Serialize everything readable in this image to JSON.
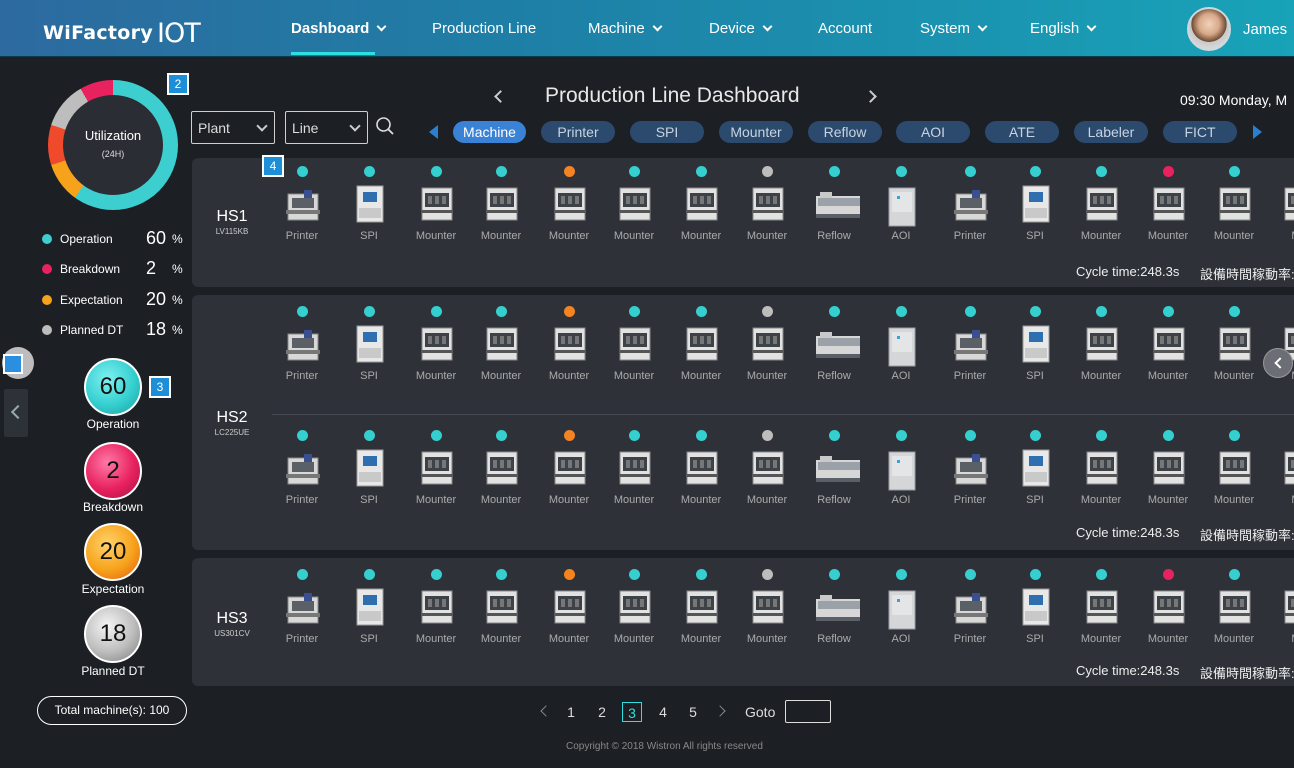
{
  "app": {
    "brand": "WiFactory",
    "brand_iot": "IOT"
  },
  "nav": {
    "items": [
      {
        "label": "Dashboard",
        "active": true,
        "has_dropdown": true
      },
      {
        "label": "Production Line",
        "active": false,
        "has_dropdown": false
      },
      {
        "label": "Machine",
        "active": false,
        "has_dropdown": true
      },
      {
        "label": "Device",
        "active": false,
        "has_dropdown": true
      },
      {
        "label": "Account",
        "active": false,
        "has_dropdown": false
      },
      {
        "label": "System",
        "active": false,
        "has_dropdown": true
      },
      {
        "label": "English",
        "active": false,
        "has_dropdown": true
      }
    ],
    "user": "James"
  },
  "utilization": {
    "title": "Utilization",
    "subtitle": "(24H)",
    "badge": "2",
    "legend": [
      {
        "label": "Operation",
        "value": "60",
        "unit": "%",
        "color": "#3dcfcf"
      },
      {
        "label": "Breakdown",
        "value": "2",
        "unit": "%",
        "color": "#e8215f"
      },
      {
        "label": "Expectation",
        "value": "20",
        "unit": "%",
        "color": "#f7a21b"
      },
      {
        "label": "Planned DT",
        "value": "18",
        "unit": "%",
        "color": "#bdbdbd"
      }
    ]
  },
  "stats": {
    "badge": "3",
    "items": [
      {
        "value": "60",
        "label": "Operation",
        "color": "#3dcfcf"
      },
      {
        "value": "2",
        "label": "Breakdown",
        "color": "#e8215f"
      },
      {
        "value": "20",
        "label": "Expectation",
        "color": "#f7a21b"
      },
      {
        "value": "18",
        "label": "Planned DT",
        "color": "#bdbdbd"
      }
    ],
    "total": "Total machine(s): 100"
  },
  "header": {
    "title": "Production Line Dashboard",
    "datetime": "09:30 Monday, M"
  },
  "filters": {
    "plant": "Plant",
    "line": "Line"
  },
  "tabs": [
    {
      "label": "Machine",
      "active": true
    },
    {
      "label": "Printer",
      "active": false
    },
    {
      "label": "SPI",
      "active": false
    },
    {
      "label": "Mounter",
      "active": false
    },
    {
      "label": "Reflow",
      "active": false
    },
    {
      "label": "AOI",
      "active": false
    },
    {
      "label": "ATE",
      "active": false
    },
    {
      "label": "Labeler",
      "active": false
    },
    {
      "label": "FICT",
      "active": false
    }
  ],
  "lines_badge": "4",
  "lines": [
    {
      "name": "HS1",
      "code": "LV115KB",
      "cycle": "Cycle time:248.3s",
      "availability": "設備時間稼動率:",
      "rows": [
        [
          {
            "type": "Printer",
            "status": "operation"
          },
          {
            "type": "SPI",
            "status": "operation"
          },
          {
            "type": "Mounter",
            "status": "operation"
          },
          {
            "type": "Mounter",
            "status": "operation"
          },
          {
            "type": "Mounter",
            "status": "expectation"
          },
          {
            "type": "Mounter",
            "status": "operation"
          },
          {
            "type": "Mounter",
            "status": "operation"
          },
          {
            "type": "Mounter",
            "status": "planned"
          },
          {
            "type": "Reflow",
            "status": "operation"
          },
          {
            "type": "AOI",
            "status": "operation"
          },
          {
            "type": "Printer",
            "status": "operation"
          },
          {
            "type": "SPI",
            "status": "operation"
          },
          {
            "type": "Mounter",
            "status": "operation"
          },
          {
            "type": "Mounter",
            "status": "breakdown"
          },
          {
            "type": "Mounter",
            "status": "operation"
          },
          {
            "type": "Mo",
            "status": "none"
          }
        ]
      ]
    },
    {
      "name": "HS2",
      "code": "LC225UE",
      "cycle": "Cycle time:248.3s",
      "availability": "設備時間稼動率:",
      "rows": [
        [
          {
            "type": "Printer",
            "status": "operation"
          },
          {
            "type": "SPI",
            "status": "operation"
          },
          {
            "type": "Mounter",
            "status": "operation"
          },
          {
            "type": "Mounter",
            "status": "operation"
          },
          {
            "type": "Mounter",
            "status": "expectation"
          },
          {
            "type": "Mounter",
            "status": "operation"
          },
          {
            "type": "Mounter",
            "status": "operation"
          },
          {
            "type": "Mounter",
            "status": "planned"
          },
          {
            "type": "Reflow",
            "status": "operation"
          },
          {
            "type": "AOI",
            "status": "operation"
          },
          {
            "type": "Printer",
            "status": "operation"
          },
          {
            "type": "SPI",
            "status": "operation"
          },
          {
            "type": "Mounter",
            "status": "operation"
          },
          {
            "type": "Mounter",
            "status": "operation"
          },
          {
            "type": "Mounter",
            "status": "operation"
          },
          {
            "type": "Mo",
            "status": "none"
          }
        ],
        [
          {
            "type": "Printer",
            "status": "operation"
          },
          {
            "type": "SPI",
            "status": "operation"
          },
          {
            "type": "Mounter",
            "status": "operation"
          },
          {
            "type": "Mounter",
            "status": "operation"
          },
          {
            "type": "Mounter",
            "status": "expectation"
          },
          {
            "type": "Mounter",
            "status": "operation"
          },
          {
            "type": "Mounter",
            "status": "operation"
          },
          {
            "type": "Mounter",
            "status": "planned"
          },
          {
            "type": "Reflow",
            "status": "operation"
          },
          {
            "type": "AOI",
            "status": "operation"
          },
          {
            "type": "Printer",
            "status": "operation"
          },
          {
            "type": "SPI",
            "status": "operation"
          },
          {
            "type": "Mounter",
            "status": "operation"
          },
          {
            "type": "Mounter",
            "status": "operation"
          },
          {
            "type": "Mounter",
            "status": "operation"
          },
          {
            "type": "Mo",
            "status": "none"
          }
        ]
      ]
    },
    {
      "name": "HS3",
      "code": "US301CV",
      "cycle": "Cycle time:248.3s",
      "availability": "設備時間稼動率:",
      "rows": [
        [
          {
            "type": "Printer",
            "status": "operation"
          },
          {
            "type": "SPI",
            "status": "operation"
          },
          {
            "type": "Mounter",
            "status": "operation"
          },
          {
            "type": "Mounter",
            "status": "operation"
          },
          {
            "type": "Mounter",
            "status": "expectation"
          },
          {
            "type": "Mounter",
            "status": "operation"
          },
          {
            "type": "Mounter",
            "status": "operation"
          },
          {
            "type": "Mounter",
            "status": "planned"
          },
          {
            "type": "Reflow",
            "status": "operation"
          },
          {
            "type": "AOI",
            "status": "operation"
          },
          {
            "type": "Printer",
            "status": "operation"
          },
          {
            "type": "SPI",
            "status": "operation"
          },
          {
            "type": "Mounter",
            "status": "operation"
          },
          {
            "type": "Mounter",
            "status": "breakdown"
          },
          {
            "type": "Mounter",
            "status": "operation"
          },
          {
            "type": "Mo",
            "status": "none"
          }
        ]
      ]
    }
  ],
  "status_colors": {
    "operation": "#35cfd0",
    "expectation": "#f5831f",
    "breakdown": "#e8215f",
    "planned": "#bdbdbd"
  },
  "pagination": {
    "pages": [
      "1",
      "2",
      "3",
      "4",
      "5"
    ],
    "current": "3",
    "goto_label": "Goto"
  },
  "footer": "Copyright © 2018 Wistron All rights reserved"
}
